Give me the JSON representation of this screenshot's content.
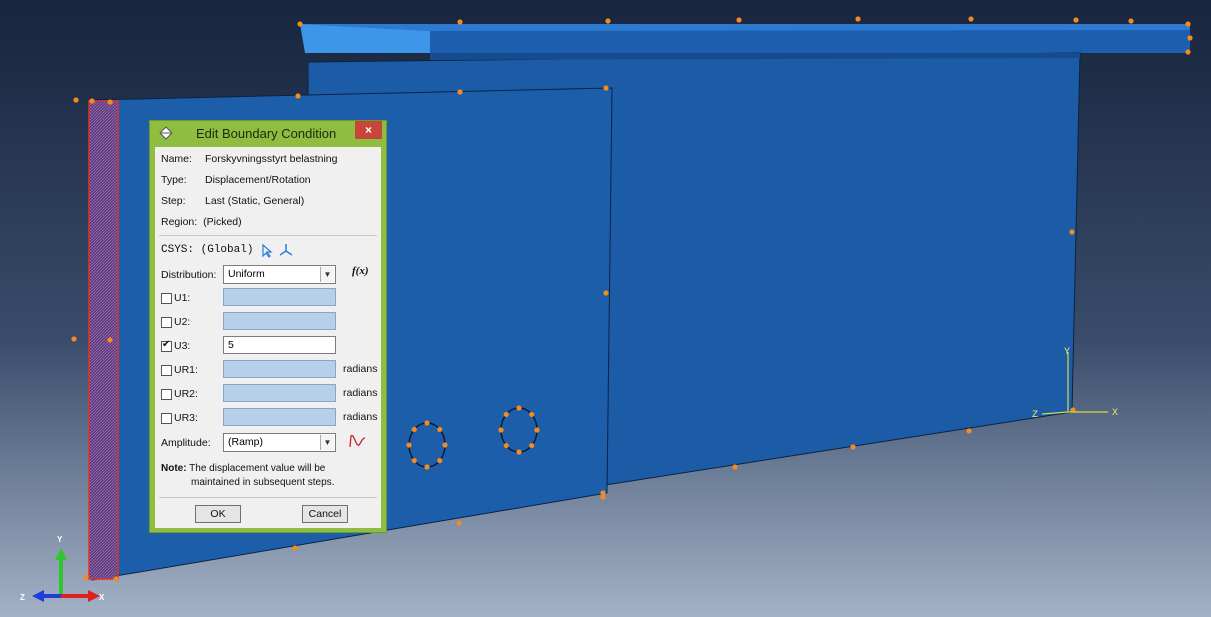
{
  "dialog": {
    "title": "Edit Boundary Condition",
    "close_symbol": "×",
    "name_label": "Name:",
    "name_value": "Forskyvningsstyrt belastning",
    "type_label": "Type:",
    "type_value": "Displacement/Rotation",
    "step_label": "Step:",
    "step_value": "Last (Static, General)",
    "region_label": "Region:",
    "region_value": "(Picked)",
    "csys_label": "CSYS:",
    "csys_value": "(Global)",
    "distribution_label": "Distribution:",
    "distribution_value": "Uniform",
    "fx_label": "f(x)",
    "dofs": [
      {
        "label": "U1:",
        "checked": false,
        "value": "",
        "unit": ""
      },
      {
        "label": "U2:",
        "checked": false,
        "value": "",
        "unit": ""
      },
      {
        "label": "U3:",
        "checked": true,
        "value": "5",
        "unit": ""
      },
      {
        "label": "UR1:",
        "checked": false,
        "value": "",
        "unit": "radians"
      },
      {
        "label": "UR2:",
        "checked": false,
        "value": "",
        "unit": "radians"
      },
      {
        "label": "UR3:",
        "checked": false,
        "value": "",
        "unit": "radians"
      }
    ],
    "amplitude_label": "Amplitude:",
    "amplitude_value": "(Ramp)",
    "note_label": "Note:",
    "note_line1": "The displacement value will be",
    "note_line2": "maintained in subsequent steps.",
    "ok_label": "OK",
    "cancel_label": "Cancel"
  },
  "triad_labels": {
    "x": "X",
    "y": "Y",
    "z": "Z"
  },
  "colors": {
    "background_top": "#18263f",
    "background_bottom": "#94a5bd",
    "part_blue": "#1a5aa4",
    "part_light": "#3a8ee6",
    "selection_red": "#e03232",
    "marker_orange": "#f58a1f",
    "dialog_frame": "#8fbd3f"
  },
  "icons": [
    "shape-icon",
    "close-icon",
    "select-pointer-icon",
    "csys-axes-icon",
    "amplitude-icon",
    "checkbox-icon",
    "dropdown-arrow-icon"
  ]
}
